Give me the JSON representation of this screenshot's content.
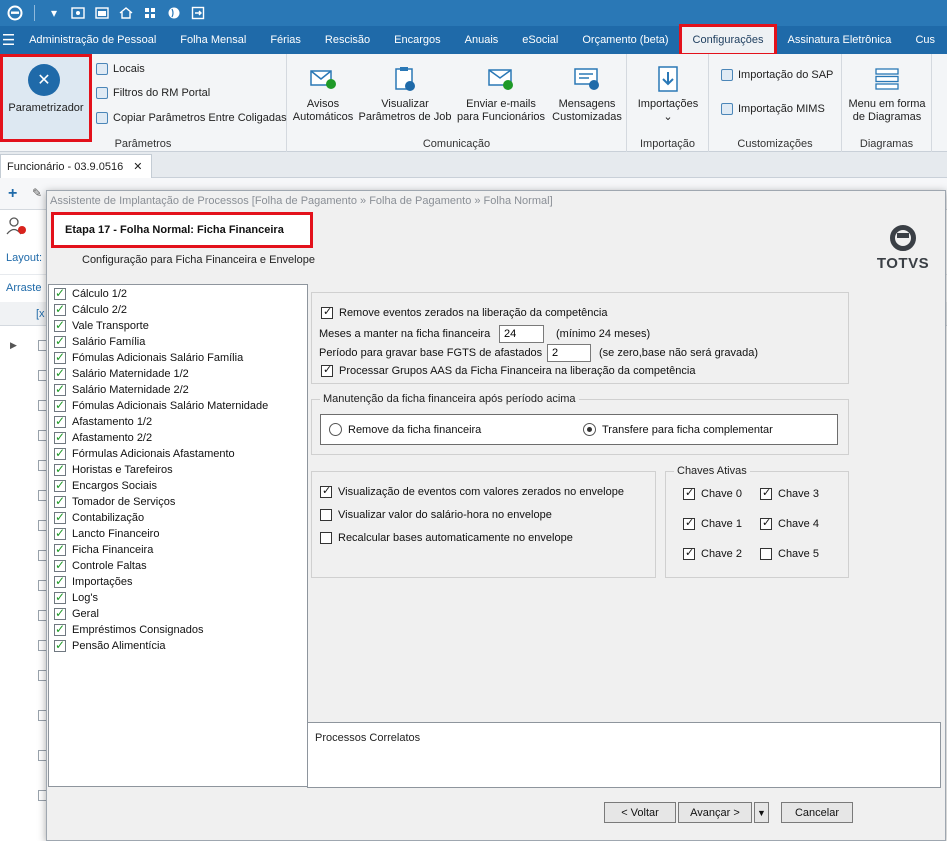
{
  "menu": {
    "items": [
      "Administração de Pessoal",
      "Folha Mensal",
      "Férias",
      "Rescisão",
      "Encargos",
      "Anuais",
      "eSocial",
      "Orçamento (beta)",
      "Configurações",
      "Assinatura Eletrônica",
      "Cus"
    ],
    "active": "Configurações"
  },
  "ribbon": {
    "parametrizador": "Parametrizador",
    "locais": "Locais",
    "filtros": "Filtros do RM Portal",
    "copiar": "Copiar Parâmetros Entre Coligadas",
    "group_parametros": "Parâmetros",
    "avisos": [
      "Avisos",
      "Automáticos"
    ],
    "visualizar": [
      "Visualizar",
      "Parâmetros de Job"
    ],
    "enviar": [
      "Enviar e-mails",
      "para Funcionários"
    ],
    "mensagens": [
      "Mensagens",
      "Customizadas"
    ],
    "group_comunicacao": "Comunicação",
    "importacoes": "Importações",
    "group_importacao": "Importação",
    "imp_sap": "Importação do SAP",
    "imp_mims": "Importação MIMS",
    "group_customizacoes": "Customizações",
    "menu_diagramas": [
      "Menu em forma",
      "de Diagramas"
    ],
    "group_diagramas": "Diagramas"
  },
  "doc_tab": {
    "label": "Funcionário - 03.9.0516",
    "close": "✕"
  },
  "background": {
    "layout": "Layout:",
    "arraste": "Arraste",
    "col_x": "[x"
  },
  "dialog": {
    "title": "Assistente de Implantação de Processos [Folha de Pagamento » Folha de Pagamento » Folha Normal]",
    "step": "Etapa 17 - Folha Normal: Ficha Financeira",
    "subtitle": "Configuração para Ficha Financeira e Envelope",
    "logo": "TOTVS",
    "steps": [
      "Cálculo 1/2",
      "Cálculo 2/2",
      "Vale Transporte",
      "Salário Família",
      "Fómulas Adicionais Salário Família",
      "Salário Maternidade 1/2",
      "Salário Maternidade 2/2",
      "Fómulas Adicionais Salário Maternidade",
      "Afastamento 1/2",
      "Afastamento 2/2",
      "Fórmulas Adicionais Afastamento",
      "Horistas e Tarefeiros",
      "Encargos Sociais",
      "Tomador de Serviços",
      "Contabilização",
      "Lancto Financeiro",
      "Ficha Financeira",
      "Controle Faltas",
      "Importações",
      "Log's",
      "Geral",
      "Empréstimos Consignados",
      "Pensão Alimentícia"
    ],
    "opt1": "Remove eventos zerados na liberação da competência",
    "meses_label": "Meses a manter na ficha financeira",
    "meses_value": "24",
    "meses_hint": "(mínimo 24 meses)",
    "periodo_label": "Período para gravar base FGTS de afastados",
    "periodo_value": "2",
    "periodo_hint": "(se zero,base não será gravada)",
    "opt2": "Processar Grupos AAS da Ficha Financeira na liberação da competência",
    "manut_legend": "Manutenção da ficha financeira após período acima",
    "radio_remove": "Remove da ficha financeira",
    "radio_transfere": "Transfere para ficha complementar",
    "env1": "Visualização de eventos com valores zerados no envelope",
    "env2": "Visualizar valor do salário-hora no envelope",
    "env3": "Recalcular bases automaticamente no envelope",
    "chaves_legend": "Chaves Ativas",
    "chaves": [
      {
        "label": "Chave 0",
        "on": true
      },
      {
        "label": "Chave 3",
        "on": true
      },
      {
        "label": "Chave 1",
        "on": true
      },
      {
        "label": "Chave 4",
        "on": true
      },
      {
        "label": "Chave 2",
        "on": true
      },
      {
        "label": "Chave 5",
        "on": false
      }
    ],
    "related": "Processos Correlatos",
    "btn_voltar": "< Voltar",
    "btn_avancar": "Avançar >",
    "btn_cancelar": "Cancelar"
  }
}
